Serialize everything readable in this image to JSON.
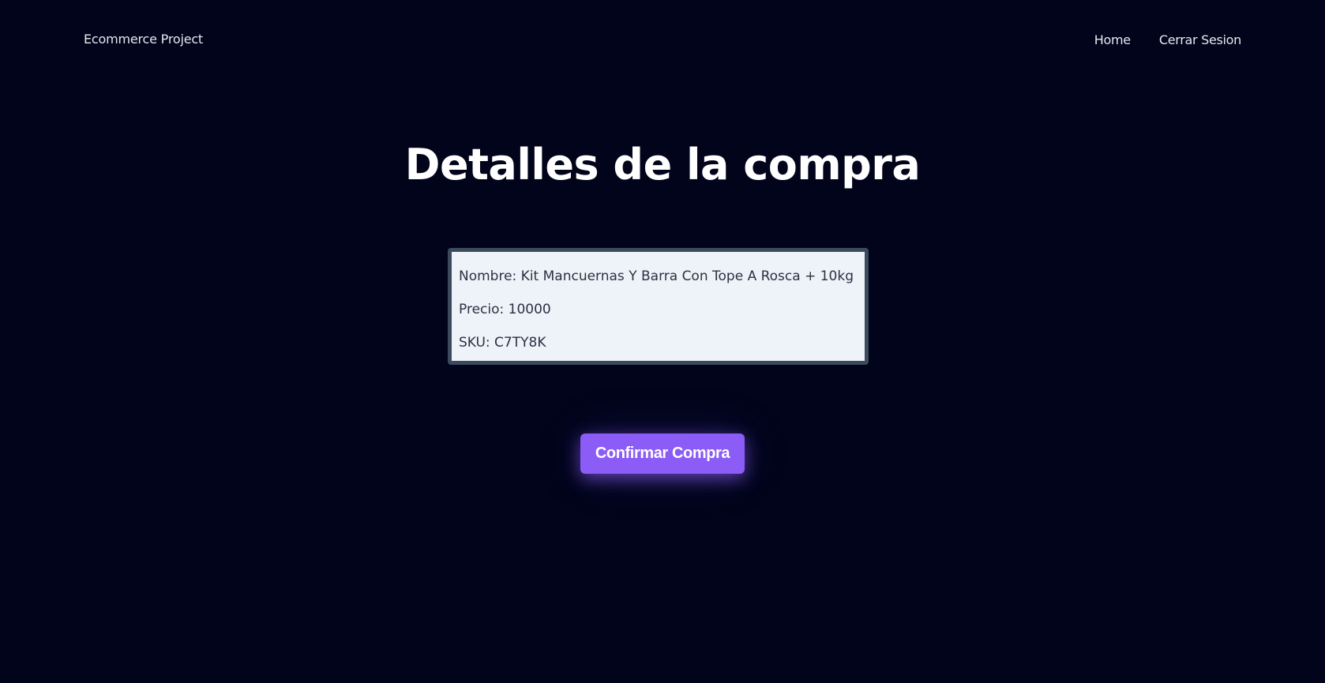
{
  "navbar": {
    "brand": "Ecommerce Project",
    "links": [
      {
        "label": "Home"
      },
      {
        "label": "Cerrar Sesion"
      }
    ]
  },
  "main": {
    "title": "Detalles de la compra",
    "details": {
      "nombre": "Nombre: Kit Mancuernas Y Barra Con Tope A Rosca + 10kg",
      "precio": "Precio: 10000",
      "sku": "SKU: C7TY8K"
    },
    "confirm_label": "Confirmar Compra"
  },
  "colors": {
    "background": "#01041a",
    "accent": "#8b5cf6",
    "card_background": "#eef3f9",
    "card_border": "#3c4a5d"
  }
}
